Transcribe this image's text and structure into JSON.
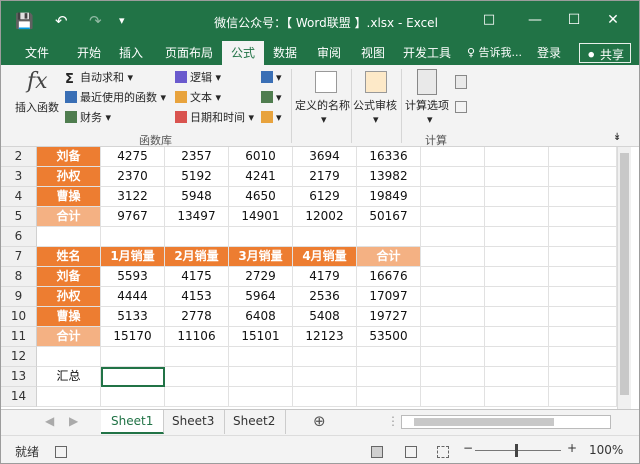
{
  "titlebar": {
    "title": "微信公众号：【 Word联盟 】.xlsx - Excel",
    "icons": [
      "save-icon",
      "undo-icon",
      "redo-icon",
      "customize-qat-icon",
      "ribbon-display-icon",
      "minimize-icon",
      "maximize-icon",
      "close-icon"
    ]
  },
  "tabs": [
    "文件",
    "开始",
    "插入",
    "页面布局",
    "公式",
    "数据",
    "审阅",
    "视图",
    "开发工具"
  ],
  "active_tab": "公式",
  "tell_me": "♀ 告诉我...",
  "login": "登录",
  "share": "共享",
  "ribbon": {
    "insert_function": "插入函数",
    "autosum": "自动求和",
    "recently_used": "最近使用的函数",
    "financial": "财务",
    "logical": "逻辑",
    "text": "文本",
    "datetime": "日期和时间",
    "defined_names": "定义的名称",
    "formula_auditing": "公式审核",
    "calc_options": "计算选项",
    "group_function_library": "函数库",
    "group_calculation": "计算"
  },
  "rows": [
    {
      "num": "2",
      "cells": [
        "刘备",
        "4275",
        "2357",
        "6010",
        "3694",
        "16336"
      ],
      "style": "data"
    },
    {
      "num": "3",
      "cells": [
        "孙权",
        "2370",
        "5192",
        "4241",
        "2179",
        "13982"
      ],
      "style": "data"
    },
    {
      "num": "4",
      "cells": [
        "曹操",
        "3122",
        "5948",
        "4650",
        "6129",
        "19849"
      ],
      "style": "data"
    },
    {
      "num": "5",
      "cells": [
        "合计",
        "9767",
        "13497",
        "14901",
        "12002",
        "50167"
      ],
      "style": "total"
    },
    {
      "num": "6",
      "cells": [
        "",
        "",
        "",
        "",
        "",
        ""
      ],
      "style": "empty"
    },
    {
      "num": "7",
      "cells": [
        "姓名",
        "1月销量",
        "2月销量",
        "3月销量",
        "4月销量",
        "合计"
      ],
      "style": "header"
    },
    {
      "num": "8",
      "cells": [
        "刘备",
        "5593",
        "4175",
        "2729",
        "4179",
        "16676"
      ],
      "style": "data"
    },
    {
      "num": "9",
      "cells": [
        "孙权",
        "4444",
        "4153",
        "5964",
        "2536",
        "17097"
      ],
      "style": "data"
    },
    {
      "num": "10",
      "cells": [
        "曹操",
        "5133",
        "2778",
        "6408",
        "5408",
        "19727"
      ],
      "style": "data"
    },
    {
      "num": "11",
      "cells": [
        "合计",
        "15170",
        "11106",
        "15101",
        "12123",
        "53500"
      ],
      "style": "total"
    },
    {
      "num": "12",
      "cells": [
        "",
        "",
        "",
        "",
        "",
        ""
      ],
      "style": "empty"
    },
    {
      "num": "13",
      "cells": [
        "汇总",
        "",
        "",
        "",
        "",
        ""
      ],
      "style": "summary"
    },
    {
      "num": "14",
      "cells": [
        "",
        "",
        "",
        "",
        "",
        ""
      ],
      "style": "empty"
    }
  ],
  "sheets": [
    "Sheet1",
    "Sheet3",
    "Sheet2"
  ],
  "active_sheet": "Sheet1",
  "status": {
    "ready": "就绪",
    "zoom": "100%"
  },
  "colors": {
    "excel_green": "#217346",
    "header_orange": "#ed7d31",
    "total_orange": "#f4b183"
  }
}
